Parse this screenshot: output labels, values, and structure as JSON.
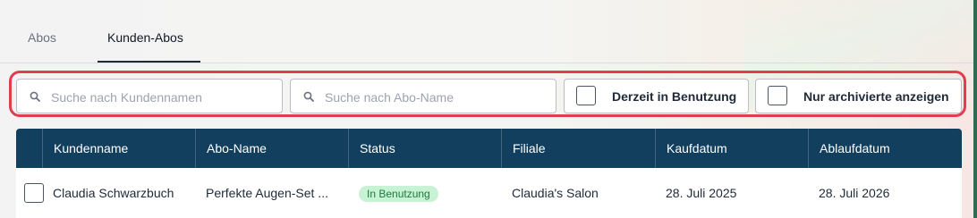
{
  "tabs": [
    {
      "label": "Abos",
      "active": false
    },
    {
      "label": "Kunden-Abos",
      "active": true
    }
  ],
  "filters": {
    "customer_search": {
      "placeholder": "Suche nach Kundennamen",
      "value": "",
      "icon": "search-icon"
    },
    "abo_search": {
      "placeholder": "Suche nach Abo-Name",
      "value": "",
      "icon": "search-icon"
    },
    "in_use_toggle": {
      "label": "Derzeit in Benutzung",
      "checked": false
    },
    "archived_toggle": {
      "label": "Nur archivierte anzeigen",
      "checked": false
    }
  },
  "table": {
    "columns": [
      "Kundenname",
      "Abo-Name",
      "Status",
      "Filiale",
      "Kaufdatum",
      "Ablaufdatum"
    ],
    "rows": [
      {
        "kundenname": "Claudia Schwarzbuch",
        "abo_name": "Perfekte Augen-Set ...",
        "status": "In Benutzung",
        "filiale": "Claudia's Salon",
        "kaufdatum": "28. Juli 2025",
        "ablaufdatum": "28. Juli 2026",
        "selected": false
      }
    ]
  },
  "colors": {
    "header_bg": "#123f5e",
    "highlight_border": "#e33b50",
    "status_badge_bg": "#c8f2d4",
    "status_badge_text": "#1f7a3d"
  }
}
